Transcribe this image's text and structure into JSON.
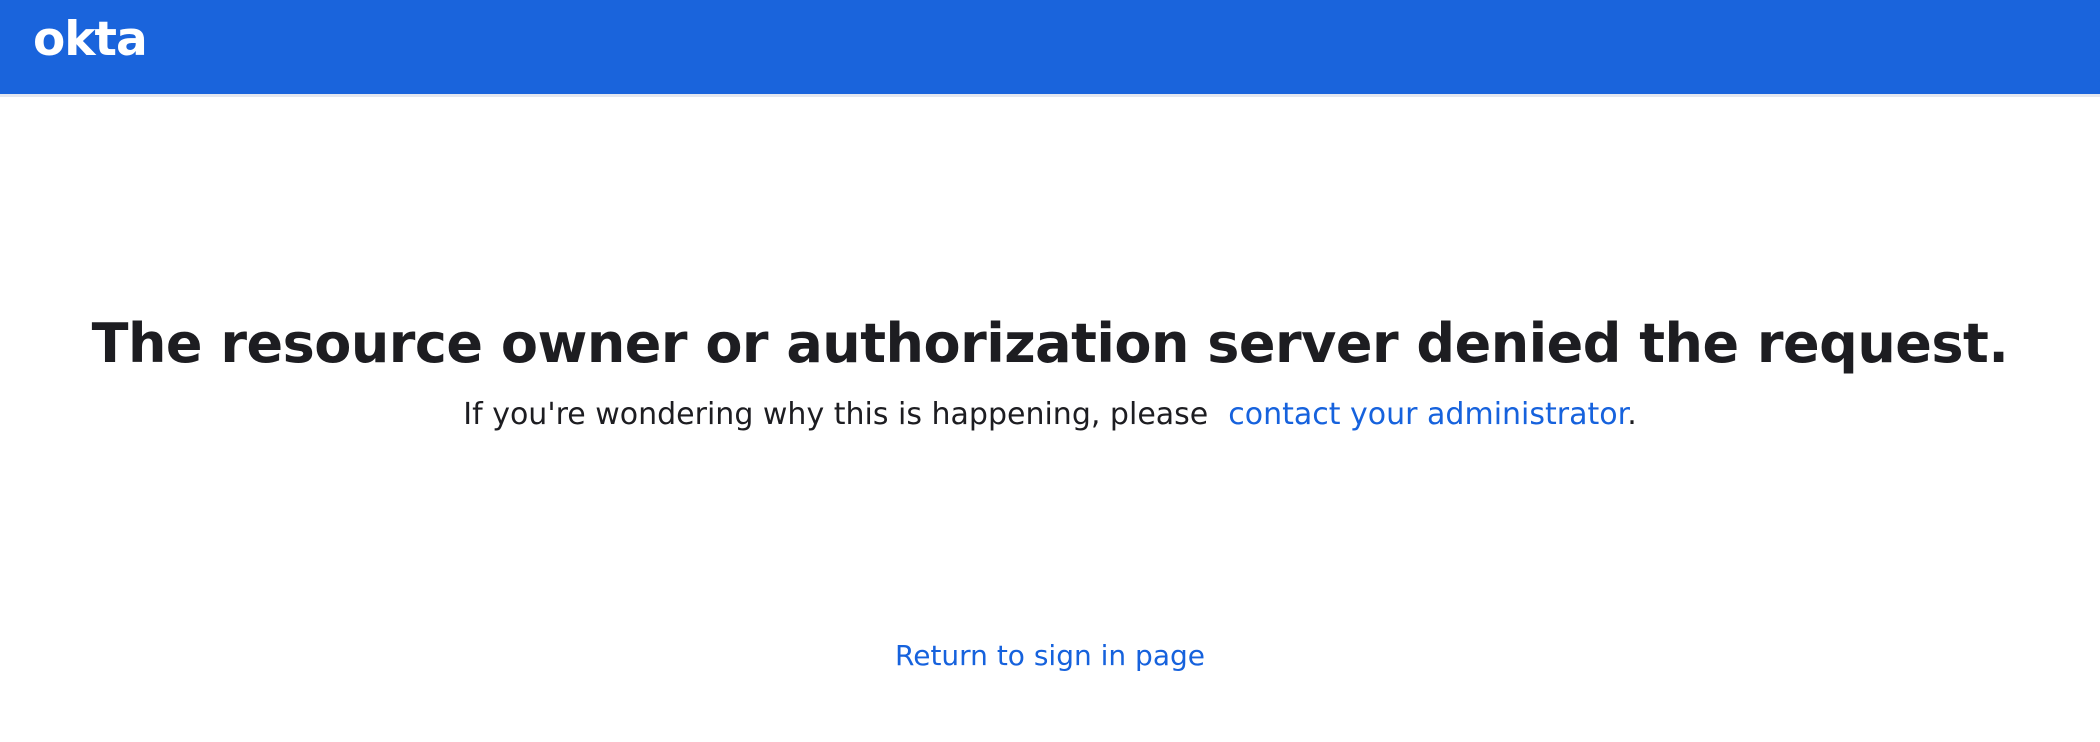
{
  "header": {
    "logo_text": "okta",
    "background_color": "#1a64dc"
  },
  "main": {
    "title": "The resource owner or authorization server denied the request.",
    "message_prefix": "If you're wondering why this is happening, please",
    "contact_link": "contact your administrator",
    "message_suffix": ".",
    "return_link": "Return to sign in page"
  },
  "colors": {
    "link": "#1662dd",
    "text": "#1d1d21"
  }
}
